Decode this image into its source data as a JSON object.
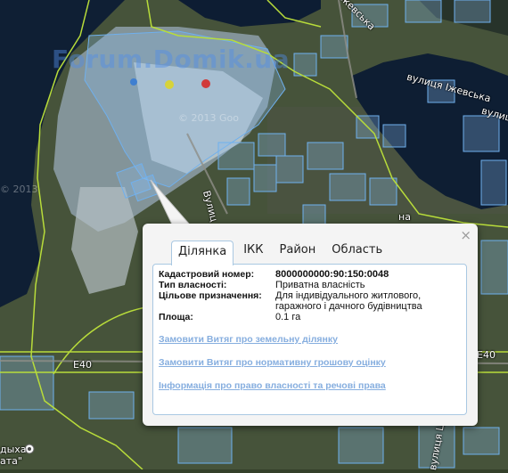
{
  "map": {
    "watermark": "Forum.Domik.ua",
    "copyright_1": "© 2013 Goo",
    "copyright_2": "© 2013",
    "streets": [
      {
        "id": "street-zhevska",
        "text": "вулиця Іжевська"
      },
      {
        "id": "street-zhevska-2",
        "text": "вулиц"
      },
      {
        "id": "street-vert",
        "text": "Вулиц"
      },
      {
        "id": "street-top",
        "text": "Ижевська"
      },
      {
        "id": "road-e40-a",
        "text": "E40"
      },
      {
        "id": "road-e40-b",
        "text": "E40"
      },
      {
        "id": "street-bottom-right",
        "text": "вулиця Цент"
      },
      {
        "id": "place-left-1",
        "text": "дыха"
      },
      {
        "id": "place-left-2",
        "text": "ата\""
      },
      {
        "id": "street-na",
        "text": "на"
      }
    ],
    "colors": {
      "water": "#0d1d33",
      "land": "#46533a",
      "boundary": "#b8dc3a",
      "parcel_fill": "rgba(140,190,240,0.30)",
      "parcel_stroke": "#6fb0ee"
    }
  },
  "popup": {
    "close_label": "×",
    "tabs": [
      {
        "label": "Ділянка",
        "active": true
      },
      {
        "label": "ІКК",
        "active": false
      },
      {
        "label": "Район",
        "active": false
      },
      {
        "label": "Область",
        "active": false
      }
    ],
    "fields": {
      "cadastral_label": "Кадастровий номер:",
      "cadastral_value": "8000000000:90:150:0048",
      "ownership_label": "Тип власності:",
      "ownership_value": "Приватна власність",
      "purpose_label": "Цільове призначення:",
      "purpose_value": "Для індивідуального житлового, гаражного і дачного будівництва",
      "area_label": "Площа:",
      "area_value": "0.1 га"
    },
    "links": [
      "Замовити Витяг про земельну ділянку",
      "Замовити Витяг про нормативну грошову оцінку",
      "Інформація про право власності та речові права"
    ]
  }
}
